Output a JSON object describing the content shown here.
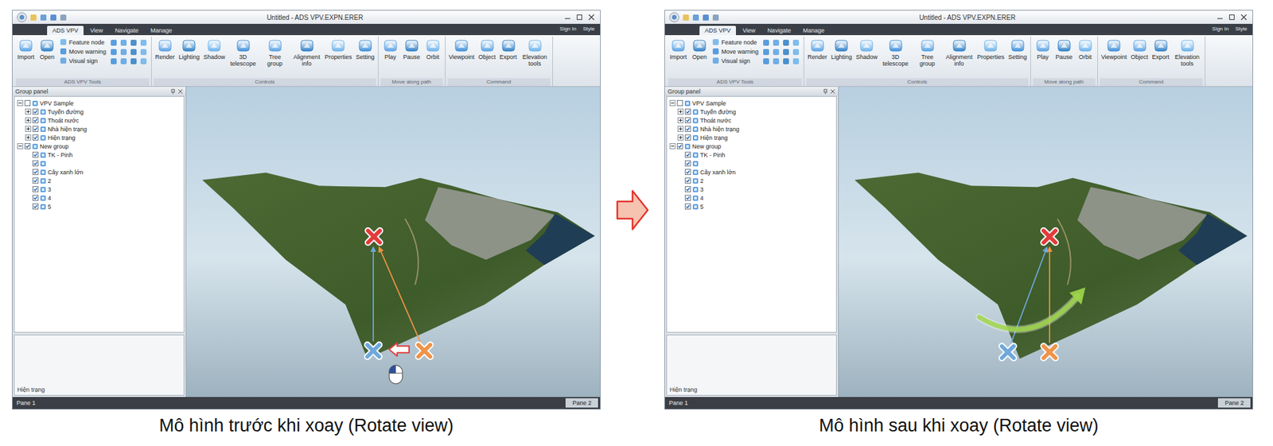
{
  "window": {
    "title": "Untitled - ADS VPV.EXPN.ERER",
    "menu_tabs": [
      {
        "label": "ADS VPV",
        "selected": true
      },
      {
        "label": "View",
        "selected": false
      },
      {
        "label": "Navigate",
        "selected": false
      },
      {
        "label": "Manage",
        "selected": false
      }
    ],
    "account": [
      "Sign In",
      "Style"
    ],
    "ribbon_groups": [
      {
        "label": "ADS VPV Tools",
        "items": [
          {
            "kind": "large",
            "label": "Import"
          },
          {
            "kind": "large",
            "label": "Open"
          },
          {
            "kind": "list",
            "entries": [
              "Feature node",
              "Move warning",
              "Visual sign"
            ]
          },
          {
            "kind": "grid"
          }
        ]
      },
      {
        "label": "Controls",
        "items": [
          {
            "kind": "large",
            "label": "Render"
          },
          {
            "kind": "large",
            "label": "Lighting"
          },
          {
            "kind": "large",
            "label": "Shadow"
          },
          {
            "kind": "large",
            "label": "3D telescope"
          },
          {
            "kind": "large",
            "label": "Tree group"
          },
          {
            "kind": "large",
            "label": "Alignment info"
          },
          {
            "kind": "large",
            "label": "Properties"
          },
          {
            "kind": "large",
            "label": "Setting"
          }
        ]
      },
      {
        "label": "Move along path",
        "items": [
          {
            "kind": "large",
            "label": "Play"
          },
          {
            "kind": "large",
            "label": "Pause"
          },
          {
            "kind": "large",
            "label": "Orbit"
          }
        ]
      },
      {
        "label": "Command",
        "items": [
          {
            "kind": "large",
            "label": "Viewpoint"
          },
          {
            "kind": "large",
            "label": "Object"
          },
          {
            "kind": "large",
            "label": "Export"
          },
          {
            "kind": "large",
            "label": "Elevation tools"
          }
        ]
      }
    ],
    "tree_panel": {
      "title": "Group panel",
      "items": [
        {
          "label": "VPV Sample",
          "checked": false,
          "expanded": true,
          "children": [
            {
              "label": "Tuyến đường",
              "checked": true,
              "expanded": false,
              "children": []
            },
            {
              "label": "Thoát nước",
              "checked": true,
              "expanded": false,
              "children": []
            },
            {
              "label": "Nhà hiện trạng",
              "checked": true,
              "expanded": false,
              "children": []
            },
            {
              "label": "Hiện trạng",
              "checked": true,
              "expanded": false,
              "children": []
            }
          ]
        },
        {
          "label": "New group",
          "checked": true,
          "expanded": true,
          "children": [
            {
              "label": "TK - Pinh",
              "checked": true
            },
            {
              "label": "",
              "checked": true
            },
            {
              "label": "Cây xanh lớn",
              "checked": true
            },
            {
              "label": "2",
              "checked": true
            },
            {
              "label": "3",
              "checked": true
            },
            {
              "label": "4",
              "checked": true
            },
            {
              "label": "5",
              "checked": true
            }
          ]
        }
      ]
    },
    "property_panel": {
      "label": "Hiện trạng"
    },
    "status_bar": {
      "left": "Pane 1",
      "right": "Pane 2"
    },
    "markers": [
      {
        "kind": "target",
        "color": "#e23b3b"
      },
      {
        "kind": "camera",
        "color": "#6fa8dc"
      },
      {
        "kind": "origin",
        "color": "#ef9348"
      }
    ]
  },
  "panels": [
    {
      "kind": "before",
      "caption": "Mô hình trước khi xoay (Rotate view)"
    },
    {
      "kind": "after",
      "caption": "Mô hình sau khi xoay (Rotate view)"
    }
  ]
}
